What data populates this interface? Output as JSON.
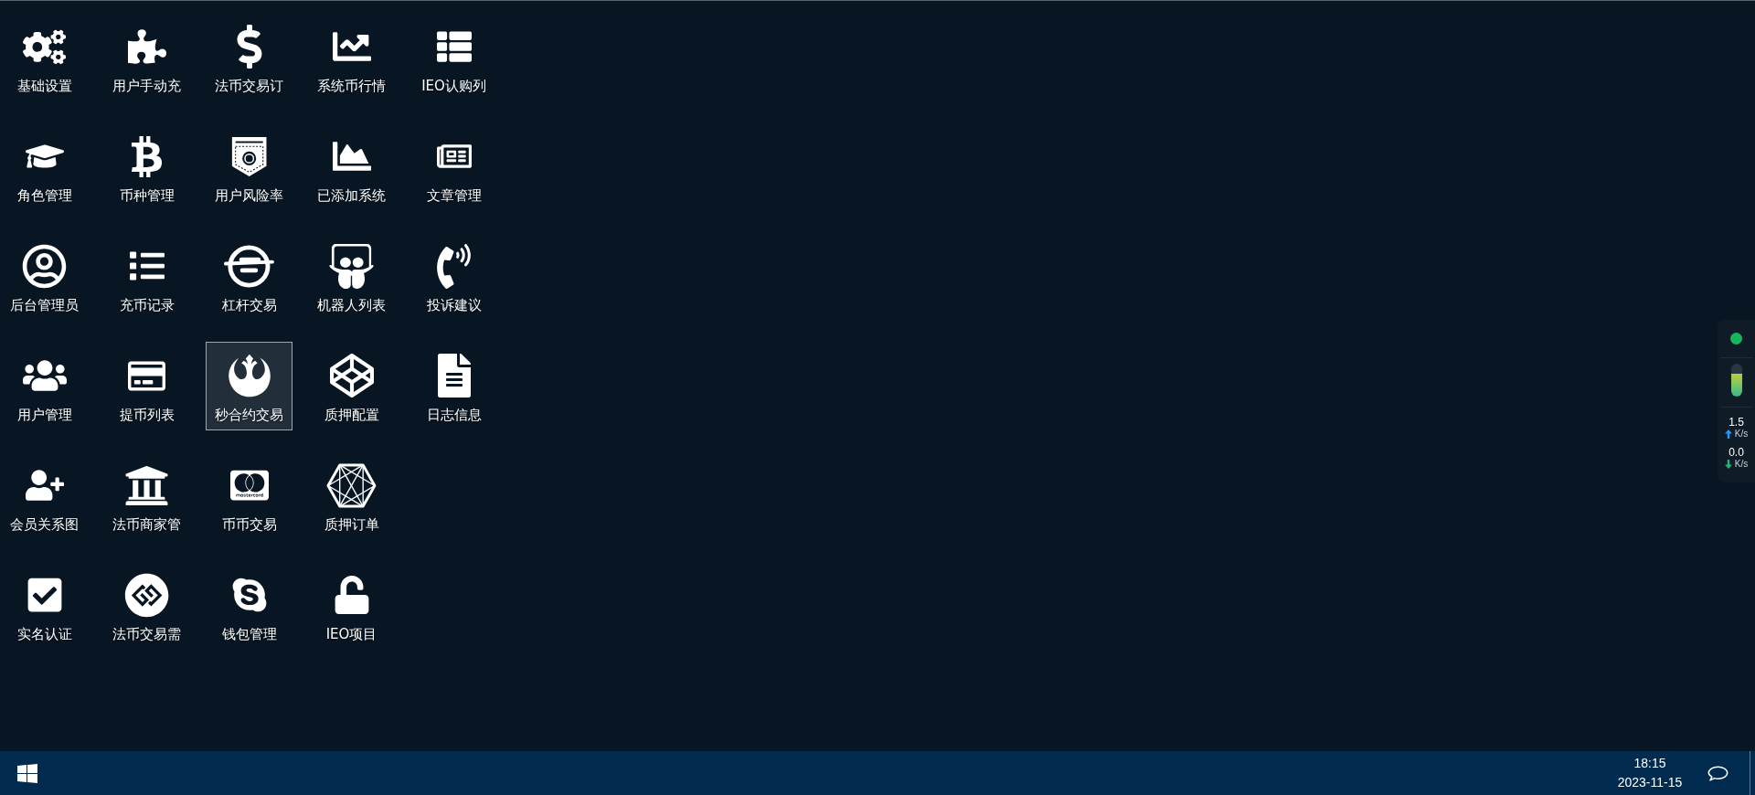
{
  "desktop": {
    "rows": [
      [
        {
          "label": "基础设置",
          "selected": false
        },
        {
          "label": "用户手动充",
          "selected": false
        },
        {
          "label": "法币交易订",
          "selected": false
        },
        {
          "label": "系统币行情",
          "selected": false
        },
        {
          "label": "IEO认购列",
          "selected": false
        }
      ],
      [
        {
          "label": "角色管理",
          "selected": false
        },
        {
          "label": "币种管理",
          "selected": false
        },
        {
          "label": "用户风险率",
          "selected": false
        },
        {
          "label": "已添加系统",
          "selected": false
        },
        {
          "label": "文章管理",
          "selected": false
        }
      ],
      [
        {
          "label": "后台管理员",
          "selected": false
        },
        {
          "label": "充币记录",
          "selected": false
        },
        {
          "label": "杠杆交易",
          "selected": false
        },
        {
          "label": "机器人列表",
          "selected": false
        },
        {
          "label": "投诉建议",
          "selected": false
        }
      ],
      [
        {
          "label": "用户管理",
          "selected": false
        },
        {
          "label": "提币列表",
          "selected": false
        },
        {
          "label": "秒合约交易",
          "selected": true
        },
        {
          "label": "质押配置",
          "selected": false
        },
        {
          "label": "日志信息",
          "selected": false
        }
      ],
      [
        {
          "label": "会员关系图",
          "selected": false
        },
        {
          "label": "法币商家管",
          "selected": false
        },
        {
          "label": "币币交易",
          "selected": false
        },
        {
          "label": "质押订单",
          "selected": false
        }
      ],
      [
        {
          "label": "实名认证",
          "selected": false
        },
        {
          "label": "法币交易需",
          "selected": false
        },
        {
          "label": "钱包管理",
          "selected": false
        },
        {
          "label": "IEO项目",
          "selected": false
        }
      ]
    ]
  },
  "monitor": {
    "online": true,
    "memory": {
      "level": 0.7
    },
    "upload": {
      "value": "1.5",
      "unit": "K/s"
    },
    "download": {
      "value": "0.0",
      "unit": "K/s"
    }
  },
  "taskbar": {
    "time": "18:15",
    "date": "2023-11-15"
  }
}
